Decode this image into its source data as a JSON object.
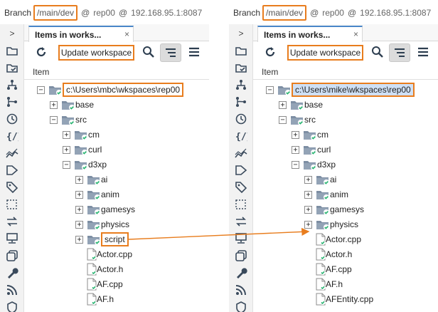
{
  "branchbar": {
    "label": "Branch",
    "branch": "/main/dev",
    "at": "@",
    "repo": "rep00",
    "server": "192.168.95.1:8087"
  },
  "sidebar_icons": [
    "collapse-arrow-icon",
    "folder-icon",
    "folder-check-icon",
    "hierarchy-icon",
    "branch-icon",
    "history-icon",
    "code-icon",
    "chart-icon",
    "label-icon",
    "tag-icon",
    "shelve-icon",
    "sync-icon",
    "monitor-icon",
    "copy-icon",
    "wrench-icon",
    "rss-icon",
    "shield-icon"
  ],
  "sidebar": {
    "collapse_glyph": ">"
  },
  "tab": {
    "label": "Items in works...",
    "close": "×"
  },
  "toolbar": {
    "update_label": "Update workspace"
  },
  "column_header": "Item",
  "accent_color": "#e87d1e",
  "left": {
    "rows": [
      {
        "depth": 0,
        "exp": "−",
        "icon": "folder",
        "label": "c:\\Users\\mbc\\wkspaces\\rep00",
        "highlight": true
      },
      {
        "depth": 1,
        "exp": "+",
        "icon": "folder",
        "label": "base"
      },
      {
        "depth": 1,
        "exp": "−",
        "icon": "folder",
        "label": "src"
      },
      {
        "depth": 2,
        "exp": "+",
        "icon": "folder",
        "label": "cm"
      },
      {
        "depth": 2,
        "exp": "+",
        "icon": "folder",
        "label": "curl"
      },
      {
        "depth": 2,
        "exp": "−",
        "icon": "folder",
        "label": "d3xp"
      },
      {
        "depth": 3,
        "exp": "+",
        "icon": "folder",
        "label": "ai"
      },
      {
        "depth": 3,
        "exp": "+",
        "icon": "folder",
        "label": "anim"
      },
      {
        "depth": 3,
        "exp": "+",
        "icon": "folder",
        "label": "gamesys"
      },
      {
        "depth": 3,
        "exp": "+",
        "icon": "folder",
        "label": "physics"
      },
      {
        "depth": 3,
        "exp": "+",
        "icon": "folder",
        "label": "script",
        "highlight": true
      },
      {
        "depth": 3,
        "exp": "",
        "icon": "file",
        "label": "Actor.cpp"
      },
      {
        "depth": 3,
        "exp": "",
        "icon": "file",
        "label": "Actor.h"
      },
      {
        "depth": 3,
        "exp": "",
        "icon": "file",
        "label": "AF.cpp"
      },
      {
        "depth": 3,
        "exp": "",
        "icon": "file",
        "label": "AF.h"
      }
    ]
  },
  "right": {
    "rows": [
      {
        "depth": 0,
        "exp": "−",
        "icon": "folder",
        "label": "c:\\Users\\mike\\wkspaces\\rep00",
        "highlight": true,
        "selected": true
      },
      {
        "depth": 1,
        "exp": "+",
        "icon": "folder",
        "label": "base"
      },
      {
        "depth": 1,
        "exp": "−",
        "icon": "folder",
        "label": "src"
      },
      {
        "depth": 2,
        "exp": "+",
        "icon": "folder",
        "label": "cm"
      },
      {
        "depth": 2,
        "exp": "+",
        "icon": "folder",
        "label": "curl"
      },
      {
        "depth": 2,
        "exp": "−",
        "icon": "folder",
        "label": "d3xp"
      },
      {
        "depth": 3,
        "exp": "+",
        "icon": "folder",
        "label": "ai"
      },
      {
        "depth": 3,
        "exp": "+",
        "icon": "folder",
        "label": "anim"
      },
      {
        "depth": 3,
        "exp": "+",
        "icon": "folder",
        "label": "gamesys"
      },
      {
        "depth": 3,
        "exp": "+",
        "icon": "folder",
        "label": "physics"
      },
      {
        "depth": 3,
        "exp": "",
        "icon": "file",
        "label": "Actor.cpp"
      },
      {
        "depth": 3,
        "exp": "",
        "icon": "file",
        "label": "Actor.h"
      },
      {
        "depth": 3,
        "exp": "",
        "icon": "file",
        "label": "AF.cpp"
      },
      {
        "depth": 3,
        "exp": "",
        "icon": "file",
        "label": "AF.h"
      },
      {
        "depth": 3,
        "exp": "",
        "icon": "file",
        "label": "AFEntity.cpp"
      }
    ]
  }
}
